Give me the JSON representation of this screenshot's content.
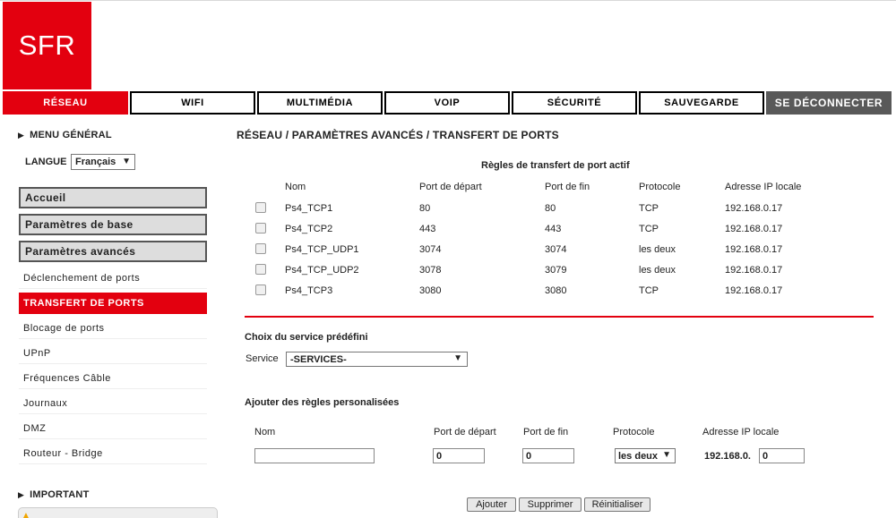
{
  "brand": {
    "logo_text": "SFR",
    "color": "#e3000f"
  },
  "nav": {
    "tabs": [
      {
        "label": "RÉSEAU",
        "active": true
      },
      {
        "label": "WIFI"
      },
      {
        "label": "MULTIMÉDIA"
      },
      {
        "label": "VOIP"
      },
      {
        "label": "SÉCURITÉ"
      },
      {
        "label": "SAUVEGARDE"
      },
      {
        "label": "SE DÉCONNECTER"
      }
    ]
  },
  "sidebar": {
    "menu_general": "MENU GÉNÉRAL",
    "language_label": "LANGUE",
    "language_value": "Français",
    "groups": [
      "Accueil",
      "Paramètres de base",
      "Paramètres avancés"
    ],
    "links": [
      {
        "label": "Déclenchement de ports"
      },
      {
        "label": "TRANSFERT DE PORTS",
        "active": true
      },
      {
        "label": "Blocage de ports"
      },
      {
        "label": "UPnP"
      },
      {
        "label": "Fréquences Câble"
      },
      {
        "label": "Journaux"
      },
      {
        "label": "DMZ"
      },
      {
        "label": "Routeur - Bridge"
      }
    ],
    "important": "IMPORTANT"
  },
  "main": {
    "breadcrumb": "RÉSEAU / PARAMÈTRES AVANCÉS / TRANSFERT DE PORTS",
    "active_rules": {
      "title": "Règles de transfert de port actif",
      "columns": [
        "Nom",
        "Port de départ",
        "Port de fin",
        "Protocole",
        "Adresse IP locale"
      ],
      "rows": [
        [
          "Ps4_TCP1",
          "80",
          "80",
          "TCP",
          "192.168.0.17"
        ],
        [
          "Ps4_TCP2",
          "443",
          "443",
          "TCP",
          "192.168.0.17"
        ],
        [
          "Ps4_TCP_UDP1",
          "3074",
          "3074",
          "les deux",
          "192.168.0.17"
        ],
        [
          "Ps4_TCP_UDP2",
          "3078",
          "3079",
          "les deux",
          "192.168.0.17"
        ],
        [
          "Ps4_TCP3",
          "3080",
          "3080",
          "TCP",
          "192.168.0.17"
        ]
      ]
    },
    "predefined": {
      "title": "Choix du service prédéfini",
      "service_label": "Service",
      "service_value": "-SERVICES-"
    },
    "custom": {
      "title": "Ajouter des règles personalisées",
      "col_name": "Nom",
      "col_start": "Port de départ",
      "col_end": "Port de fin",
      "col_proto": "Protocole",
      "col_ip": "Adresse IP locale",
      "name_value": "",
      "start_value": "0",
      "end_value": "0",
      "proto_value": "les deux",
      "ip_prefix": "192.168.0.",
      "ip_last_value": "0"
    },
    "buttons": {
      "add": "Ajouter",
      "delete": "Supprimer",
      "reset": "Réinitialiser"
    }
  }
}
